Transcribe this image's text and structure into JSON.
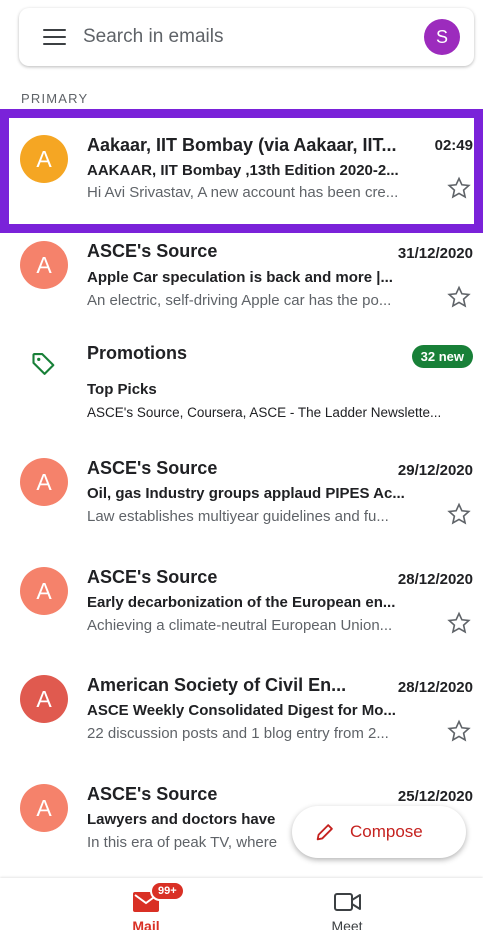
{
  "search": {
    "placeholder": "Search in emails",
    "avatar_letter": "S"
  },
  "section": "PRIMARY",
  "emails": [
    {
      "sender": "Aakaar, IIT Bombay (via Aakaar, IIT...",
      "date": "02:49",
      "subject": "AAKAAR, IIT Bombay ,13th Edition 2020-2...",
      "snippet": "Hi Avi Srivastav, A new account has been cre...",
      "avatar": "A",
      "color": "#f5a623"
    },
    {
      "sender": "ASCE's Source",
      "date": "31/12/2020",
      "subject": "Apple Car speculation is back and more |...",
      "snippet": "An electric, self-driving Apple car has the po...",
      "avatar": "A",
      "color": "#f5826b"
    },
    {
      "sender": "ASCE's Source",
      "date": "29/12/2020",
      "subject": "Oil, gas Industry groups applaud PIPES Ac...",
      "snippet": "Law establishes multiyear guidelines and fu...",
      "avatar": "A",
      "color": "#f5826b"
    },
    {
      "sender": "ASCE's Source",
      "date": "28/12/2020",
      "subject": "Early decarbonization of the European en...",
      "snippet": "Achieving a climate-neutral European Union...",
      "avatar": "A",
      "color": "#f5826b"
    },
    {
      "sender": "American Society of Civil En...",
      "date": "28/12/2020",
      "subject": "ASCE Weekly Consolidated Digest for Mo...",
      "snippet": "22 discussion posts and 1 blog entry from 2...",
      "avatar": "A",
      "color": "#e05a4f"
    },
    {
      "sender": "ASCE's Source",
      "date": "25/12/2020",
      "subject": "Lawyers and doctors have",
      "snippet": "In this era of peak TV, where",
      "avatar": "A",
      "color": "#f5826b"
    }
  ],
  "promotions": {
    "label": "Promotions",
    "badge": "32 new",
    "subject": "Top Picks",
    "snippet": "ASCE's Source, Coursera, ASCE - The Ladder Newslette...",
    "accent": "#188038"
  },
  "compose": {
    "label": "Compose"
  },
  "nav": {
    "mail_label": "Mail",
    "mail_badge": "99+",
    "meet_label": "Meet"
  }
}
